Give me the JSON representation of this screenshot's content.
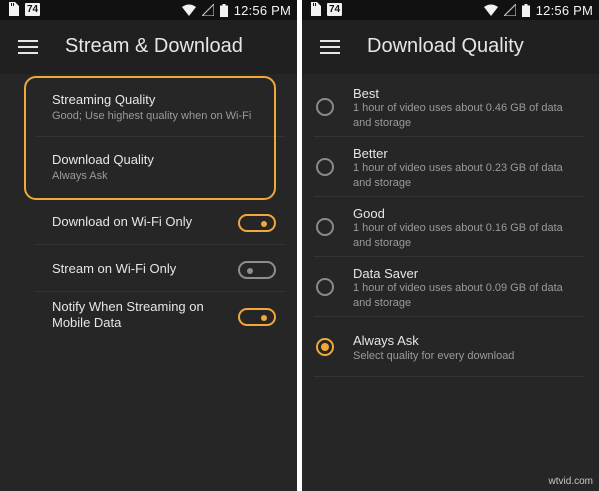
{
  "status_bar": {
    "badge": "74",
    "time": "12:56 PM"
  },
  "left_screen": {
    "title": "Stream & Download",
    "items": [
      {
        "title": "Streaming Quality",
        "subtitle": "Good; Use highest quality when on Wi-Fi"
      },
      {
        "title": "Download Quality",
        "subtitle": "Always Ask"
      }
    ],
    "toggles": [
      {
        "label": "Download on Wi-Fi Only",
        "on": true
      },
      {
        "label": "Stream on Wi-Fi Only",
        "on": false
      },
      {
        "label_line1": "Notify When Streaming on",
        "label_line2": "Mobile Data",
        "on": true
      }
    ]
  },
  "right_screen": {
    "title": "Download Quality",
    "options": [
      {
        "title": "Best",
        "desc_line1": "1 hour of video uses about 0.46 GB of data",
        "desc_line2": "and storage",
        "selected": false
      },
      {
        "title": "Better",
        "desc_line1": "1 hour of video uses about 0.23 GB of data",
        "desc_line2": "and storage",
        "selected": false
      },
      {
        "title": "Good",
        "desc_line1": "1 hour of video uses about 0.16 GB of data",
        "desc_line2": "and storage",
        "selected": false
      },
      {
        "title": "Data Saver",
        "desc_line1": "1 hour of video uses about 0.09 GB of data",
        "desc_line2": "and storage",
        "selected": false
      },
      {
        "title": "Always Ask",
        "desc_line1": "Select quality for every download",
        "selected": true
      }
    ]
  },
  "watermark": "wtvid.com",
  "colors": {
    "accent": "#f0a83a",
    "background": "#262626",
    "appbar": "#202020",
    "statusbar": "#111111"
  }
}
